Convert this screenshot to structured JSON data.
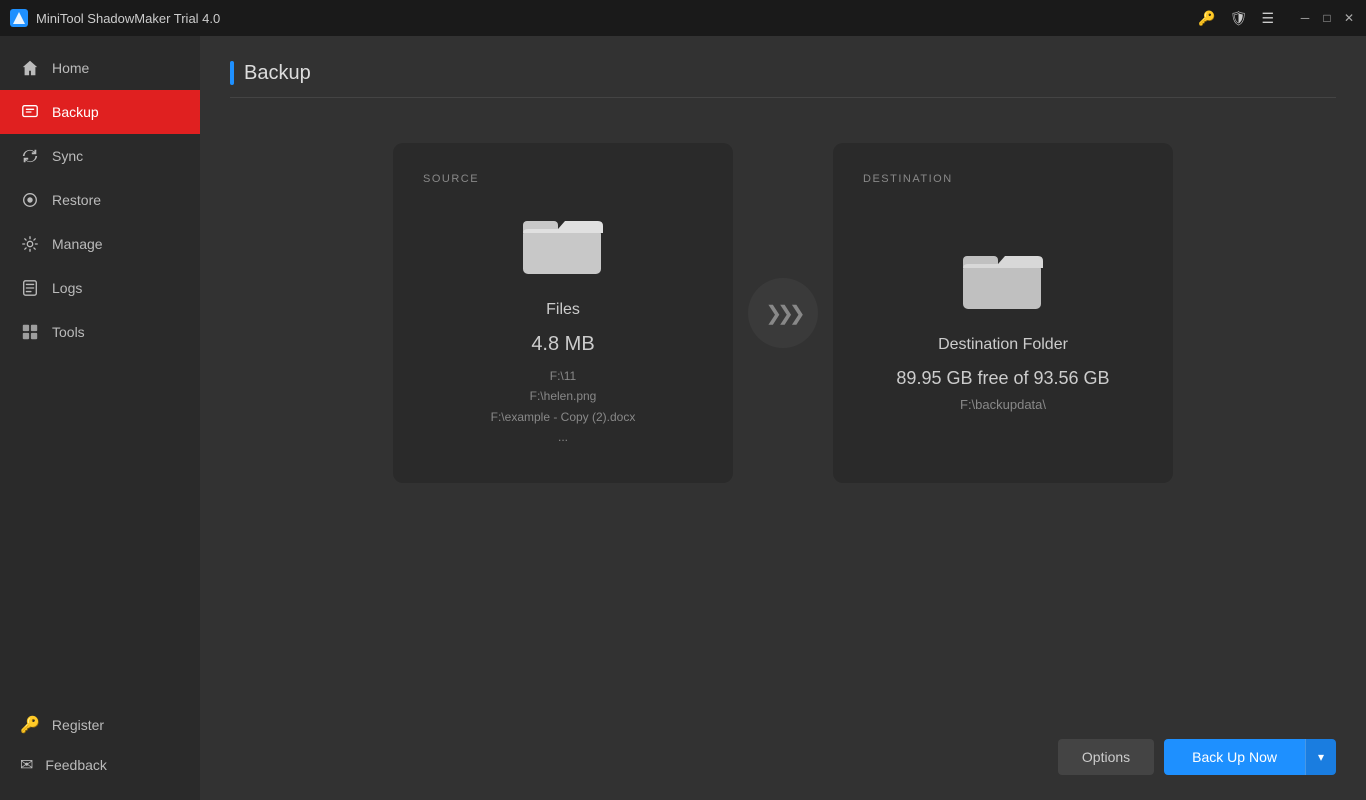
{
  "titleBar": {
    "appTitle": "MiniTool ShadowMaker Trial 4.0",
    "icons": {
      "key": "🔑",
      "shield": "🛡",
      "menu": "☰",
      "minimize": "─",
      "maximize": "□",
      "close": "✕"
    }
  },
  "sidebar": {
    "items": [
      {
        "id": "home",
        "label": "Home",
        "icon": "home"
      },
      {
        "id": "backup",
        "label": "Backup",
        "icon": "backup",
        "active": true
      },
      {
        "id": "sync",
        "label": "Sync",
        "icon": "sync"
      },
      {
        "id": "restore",
        "label": "Restore",
        "icon": "restore"
      },
      {
        "id": "manage",
        "label": "Manage",
        "icon": "manage"
      },
      {
        "id": "logs",
        "label": "Logs",
        "icon": "logs"
      },
      {
        "id": "tools",
        "label": "Tools",
        "icon": "tools"
      }
    ],
    "bottomItems": [
      {
        "id": "register",
        "label": "Register",
        "icon": "key"
      },
      {
        "id": "feedback",
        "label": "Feedback",
        "icon": "mail"
      }
    ]
  },
  "page": {
    "title": "Backup"
  },
  "source": {
    "label": "SOURCE",
    "type": "Files",
    "size": "4.8 MB",
    "paths": [
      "F:\\11",
      "F:\\helen.png",
      "F:\\example - Copy (2).docx",
      "..."
    ]
  },
  "destination": {
    "label": "DESTINATION",
    "type": "Destination Folder",
    "freeSpace": "89.95 GB free of 93.56 GB",
    "path": "F:\\backupdata\\"
  },
  "buttons": {
    "options": "Options",
    "backupNow": "Back Up Now",
    "dropdownArrow": "▾"
  }
}
